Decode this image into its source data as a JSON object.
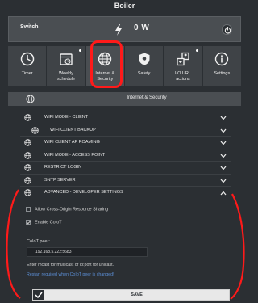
{
  "app": {
    "title": "Boiler"
  },
  "device": {
    "name": "Switch",
    "power": "0 W"
  },
  "tabs": [
    {
      "label": "Timer",
      "icon": "clock-icon",
      "dot": false
    },
    {
      "label": "Weekly\nschedule",
      "icon": "calendar-icon",
      "dot": true
    },
    {
      "label": "Internet &\nSecurity",
      "icon": "globe-icon",
      "dot": false,
      "active": true
    },
    {
      "label": "Safety",
      "icon": "shield-icon",
      "dot": false
    },
    {
      "label": "I/O URL\nactions",
      "icon": "io-actions-icon",
      "dot": true
    },
    {
      "label": "Settings",
      "icon": "info-icon",
      "dot": false
    }
  ],
  "section": {
    "title": "Internet & Security"
  },
  "settings_list": [
    {
      "label": "WIFI MODE - CLIENT",
      "sub": false
    },
    {
      "label": "WIFI CLIENT BACKUP",
      "sub": true
    },
    {
      "label": "WIFI CLIENT AP ROAMING",
      "sub": false
    },
    {
      "label": "WIFI MODE - ACCESS POINT",
      "sub": false
    },
    {
      "label": "RESTRICT LOGIN",
      "sub": false
    },
    {
      "label": "SNTP SERVER",
      "sub": false
    },
    {
      "label": "ADVANCED - DEVELOPER SETTINGS",
      "sub": false,
      "expanded": true
    }
  ],
  "advanced": {
    "cors_label": "Allow Cross-Origin Resource Sharing",
    "cors_checked": false,
    "coiot_enable_label": "Enable CoIoT",
    "coiot_enable_checked": true,
    "coiot_peer_label": "CoIoT peer:",
    "coiot_peer_value": "192.168.5.222:5683",
    "hint": "Enter mcast for multicast or ip:port for unicast.",
    "restart_note": "Restart required when CoIoT peer is changed!"
  },
  "save": {
    "label": "SAVE"
  },
  "colors": {
    "background": "#2b2f33",
    "panel": "#4a4e52",
    "accent_link": "#5c8fd6",
    "annotation": "#ff1a1a"
  }
}
